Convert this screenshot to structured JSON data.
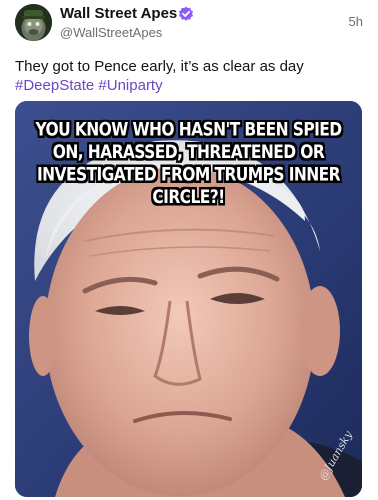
{
  "author": {
    "name": "Wall Street Apes",
    "handle": "@WallStreetApes",
    "avatar_icon": "ape-avatar-icon",
    "verified_icon": "verified-badge-icon"
  },
  "timestamp": "5h",
  "post": {
    "text": "They got to Pence early, it’s as clear as day",
    "hashtags": [
      "#DeepState",
      "#Uniparty"
    ]
  },
  "media": {
    "caption_lines": [
      "YOU KNOW WHO HASN'T BEEN SPIED",
      "ON, HARASSED, THREATENED OR",
      "INVESTIGATED FROM TRUMPS INNER CIRCLE?!"
    ],
    "watermark": "@Juansky"
  },
  "colors": {
    "hashtag": "#6b46c1",
    "verified": "#8b5cf6",
    "secondary_text": "#6b6f74"
  }
}
